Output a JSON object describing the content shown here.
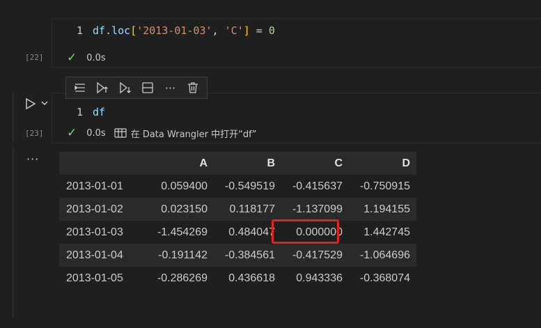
{
  "cell1": {
    "line_number": "1",
    "code": {
      "ident": "df",
      "dot": ".",
      "method": "loc",
      "open": "[",
      "arg1": "'2013-01-03'",
      "comma": ", ",
      "arg2": "'C'",
      "close": "]",
      "assign": " = ",
      "value": "0"
    },
    "exec_count": "[22]",
    "duration": "0.0s"
  },
  "cell2": {
    "line_number": "1",
    "code": "df",
    "exec_count": "[23]",
    "duration": "0.0s",
    "data_wrangler_label": "在 Data Wrangler 中打开“df”"
  },
  "toolbar": {
    "buttons": [
      "run-by-line-icon",
      "execute-above-icon",
      "execute-below-icon",
      "split-cell-icon",
      "more-actions-icon",
      "delete-cell-icon"
    ],
    "more_label": "···"
  },
  "output": {
    "more_label": "···",
    "columns": [
      "",
      "A",
      "B",
      "C",
      "D"
    ],
    "rows": [
      [
        "2013-01-01",
        "0.059400",
        "-0.549519",
        "-0.415637",
        "-0.750915"
      ],
      [
        "2013-01-02",
        "0.023150",
        "0.118177",
        "-1.137099",
        "1.194155"
      ],
      [
        "2013-01-03",
        "-1.454269",
        "0.484047",
        "0.000000",
        "1.442745"
      ],
      [
        "2013-01-04",
        "-0.191142",
        "-0.384561",
        "-0.417529",
        "-1.064696"
      ],
      [
        "2013-01-05",
        "-0.286269",
        "0.436618",
        "0.943336",
        "-0.368074"
      ]
    ],
    "highlight_color": "#e0261c"
  }
}
